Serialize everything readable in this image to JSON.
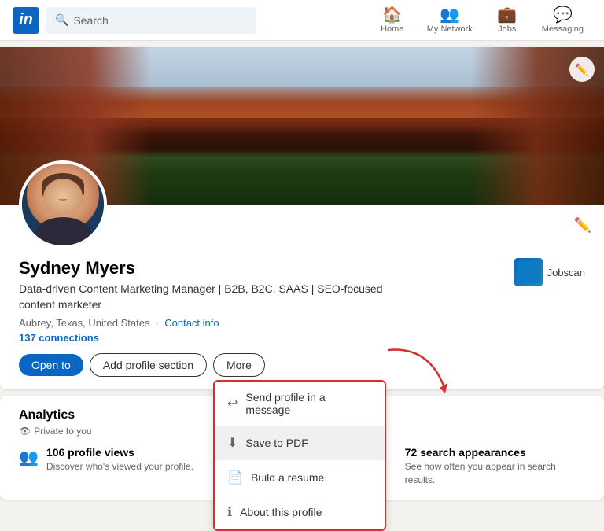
{
  "nav": {
    "logo": "in",
    "search_placeholder": "Search",
    "items": [
      {
        "id": "home",
        "label": "Home",
        "icon": "🏠"
      },
      {
        "id": "network",
        "label": "My Network",
        "icon": "👥"
      },
      {
        "id": "jobs",
        "label": "Jobs",
        "icon": "💼"
      },
      {
        "id": "messaging",
        "label": "Messaging",
        "icon": "💬"
      }
    ]
  },
  "profile": {
    "name": "Sydney Myers",
    "headline": "Data-driven Content Marketing Manager | B2B, B2C, SAAS | SEO-focused content marketer",
    "location": "Aubrey, Texas, United States",
    "contact_info": "Contact info",
    "connections": "137 connections",
    "company": "Jobscan",
    "edit_icon": "✏️"
  },
  "buttons": {
    "open_to": "Open to",
    "add_section": "Add profile section",
    "more": "More"
  },
  "dropdown": {
    "items": [
      {
        "id": "send-profile",
        "label": "Send profile in a message",
        "icon": "↩"
      },
      {
        "id": "save-pdf",
        "label": "Save to PDF",
        "icon": "⬇"
      },
      {
        "id": "build-resume",
        "label": "Build a resume",
        "icon": "📄"
      },
      {
        "id": "about-profile",
        "label": "About this profile",
        "icon": "ℹ"
      }
    ]
  },
  "analytics": {
    "title": "Analytics",
    "private_label": "Private to you",
    "items": [
      {
        "id": "profile-views",
        "icon": "👥",
        "count": "106 profile views",
        "desc": "Discover who's viewed your profile."
      },
      {
        "id": "search-appearances",
        "icon": "📊",
        "count": "72 search appearances",
        "desc": "See how often you appear in search results."
      }
    ]
  }
}
